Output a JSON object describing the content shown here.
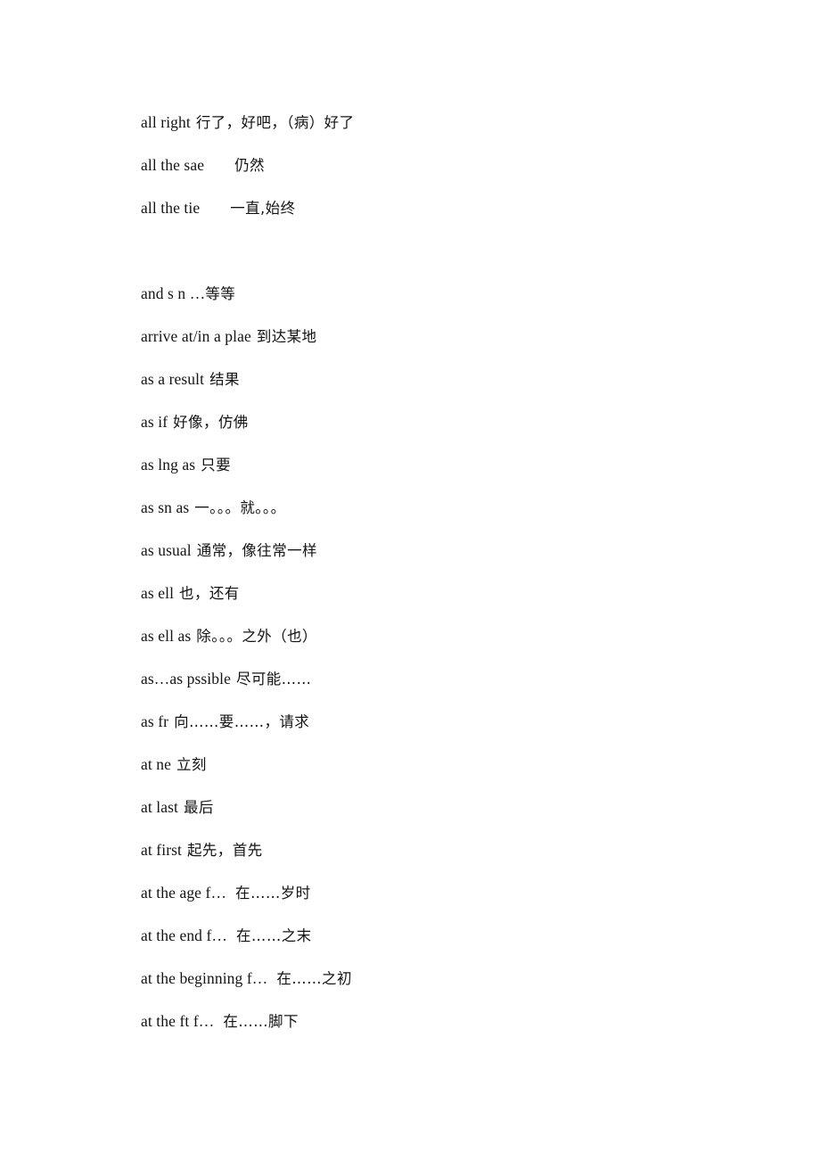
{
  "document": {
    "type": "phrase-glossary-page",
    "language_pair": "English-Chinese",
    "background_color": "#ffffff",
    "text_color": "#141414"
  },
  "entries": [
    {
      "term": "all right",
      "gap": "sm",
      "gloss": "行了，好吧，（病）好了"
    },
    {
      "term": "all the sae",
      "gap": "lg",
      "gloss": "仍然"
    },
    {
      "term": "all the tie",
      "gap": "lg",
      "gloss": "一直,始终"
    },
    {
      "term": "",
      "gap": "sm",
      "gloss": "",
      "blank": true
    },
    {
      "term": "and s n …",
      "gap": "none",
      "gloss": "等等"
    },
    {
      "term": "arrive at/in a plae",
      "gap": "sm",
      "gloss": "到达某地"
    },
    {
      "term": "as a result",
      "gap": "sm",
      "gloss": "结果"
    },
    {
      "term": "as if",
      "gap": "sm",
      "gloss": "好像，仿佛"
    },
    {
      "term": "as lng as",
      "gap": "sm",
      "gloss": "只要"
    },
    {
      "term": "as sn as",
      "gap": "sm",
      "gloss": "一。。。就。。。"
    },
    {
      "term": "as usual",
      "gap": "sm",
      "gloss": "通常，像往常一样"
    },
    {
      "term": "as ell",
      "gap": "sm",
      "gloss": "也，还有"
    },
    {
      "term": "as ell as",
      "gap": "sm",
      "gloss": "除。。。之外（也）"
    },
    {
      "term": "as…as pssible",
      "gap": "sm",
      "gloss": "尽可能……"
    },
    {
      "term": "as fr",
      "gap": "sm",
      "gloss": "向……要……，请求"
    },
    {
      "term": "at ne",
      "gap": "sm",
      "gloss": "立刻"
    },
    {
      "term": "at last",
      "gap": "sm",
      "gloss": "最后"
    },
    {
      "term": "at first",
      "gap": "sm",
      "gloss": "起先，首先"
    },
    {
      "term": "at the age f…",
      "gap": "md",
      "gloss": "在……岁时"
    },
    {
      "term": "at the end f…",
      "gap": "md",
      "gloss": "在……之末"
    },
    {
      "term": "at the beginning f…",
      "gap": "md",
      "gloss": "在……之初"
    },
    {
      "term": "at the ft f…",
      "gap": "md",
      "gloss": "在……脚下"
    }
  ]
}
